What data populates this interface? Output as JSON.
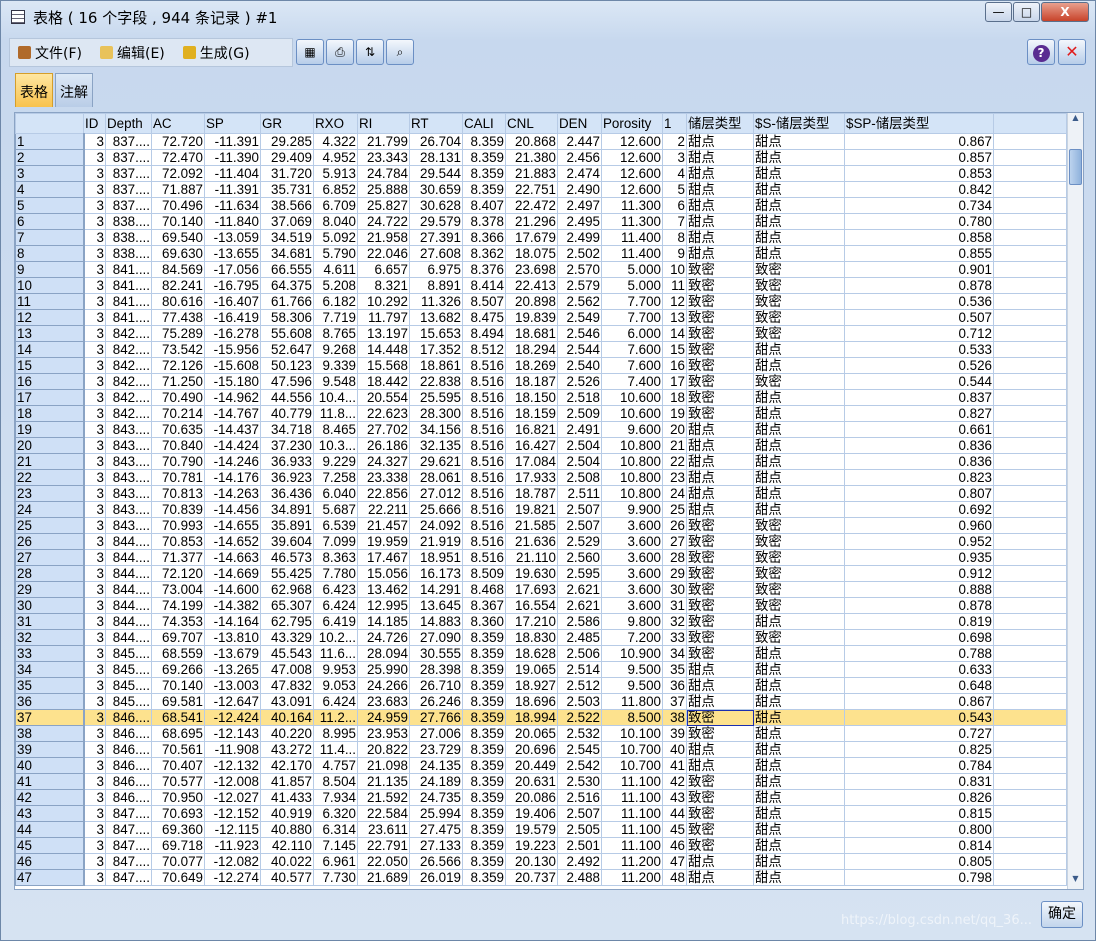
{
  "window": {
    "title": "表格 ( 16 个字段 , 944 条记录 ) #1",
    "minimize": "—",
    "maximize": "□",
    "close": "X"
  },
  "menu": [
    {
      "label": "文件(F)",
      "icon": "file-icon",
      "color": "#b06a2a"
    },
    {
      "label": "编辑(E)",
      "icon": "edit-icon",
      "color": "#e8c25a"
    },
    {
      "label": "生成(G)",
      "icon": "generate-icon",
      "color": "#e0b020"
    }
  ],
  "toolbar": [
    {
      "name": "export-icon",
      "glyph": "▦"
    },
    {
      "name": "print-icon",
      "glyph": "⎙"
    },
    {
      "name": "sort-icon",
      "glyph": "⇅"
    },
    {
      "name": "find-icon",
      "glyph": "⌕"
    }
  ],
  "help_label": "?",
  "close_label": "✕",
  "tabs": [
    {
      "label": "表格",
      "active": true
    },
    {
      "label": "注解",
      "active": false
    }
  ],
  "columns": [
    "",
    "ID",
    "Depth",
    "AC",
    "SP",
    "GR",
    "RXO",
    "RI",
    "RT",
    "CALI",
    "CNL",
    "DEN",
    "Porosity",
    "1",
    "储层类型",
    "$S-储层类型",
    "$SP-储层类型"
  ],
  "rows": [
    [
      "1",
      "3",
      "837....",
      "72.720",
      "-11.391",
      "29.285",
      "4.322",
      "21.799",
      "26.704",
      "8.359",
      "20.868",
      "2.447",
      "12.600",
      "2",
      "甜点",
      "甜点",
      "0.867"
    ],
    [
      "2",
      "3",
      "837....",
      "72.470",
      "-11.390",
      "29.409",
      "4.952",
      "23.343",
      "28.131",
      "8.359",
      "21.380",
      "2.456",
      "12.600",
      "3",
      "甜点",
      "甜点",
      "0.857"
    ],
    [
      "3",
      "3",
      "837....",
      "72.092",
      "-11.404",
      "31.720",
      "5.913",
      "24.784",
      "29.544",
      "8.359",
      "21.883",
      "2.474",
      "12.600",
      "4",
      "甜点",
      "甜点",
      "0.853"
    ],
    [
      "4",
      "3",
      "837....",
      "71.887",
      "-11.391",
      "35.731",
      "6.852",
      "25.888",
      "30.659",
      "8.359",
      "22.751",
      "2.490",
      "12.600",
      "5",
      "甜点",
      "甜点",
      "0.842"
    ],
    [
      "5",
      "3",
      "837....",
      "70.496",
      "-11.634",
      "38.566",
      "6.709",
      "25.827",
      "30.628",
      "8.407",
      "22.472",
      "2.497",
      "11.300",
      "6",
      "甜点",
      "甜点",
      "0.734"
    ],
    [
      "6",
      "3",
      "838....",
      "70.140",
      "-11.840",
      "37.069",
      "8.040",
      "24.722",
      "29.579",
      "8.378",
      "21.296",
      "2.495",
      "11.300",
      "7",
      "甜点",
      "甜点",
      "0.780"
    ],
    [
      "7",
      "3",
      "838....",
      "69.540",
      "-13.059",
      "34.519",
      "5.092",
      "21.958",
      "27.391",
      "8.366",
      "17.679",
      "2.499",
      "11.400",
      "8",
      "甜点",
      "甜点",
      "0.858"
    ],
    [
      "8",
      "3",
      "838....",
      "69.630",
      "-13.655",
      "34.681",
      "5.790",
      "22.046",
      "27.608",
      "8.362",
      "18.075",
      "2.502",
      "11.400",
      "9",
      "甜点",
      "甜点",
      "0.855"
    ],
    [
      "9",
      "3",
      "841....",
      "84.569",
      "-17.056",
      "66.555",
      "4.611",
      "6.657",
      "6.975",
      "8.376",
      "23.698",
      "2.570",
      "5.000",
      "10",
      "致密",
      "致密",
      "0.901"
    ],
    [
      "10",
      "3",
      "841....",
      "82.241",
      "-16.795",
      "64.375",
      "5.208",
      "8.321",
      "8.891",
      "8.414",
      "22.413",
      "2.579",
      "5.000",
      "11",
      "致密",
      "致密",
      "0.878"
    ],
    [
      "11",
      "3",
      "841....",
      "80.616",
      "-16.407",
      "61.766",
      "6.182",
      "10.292",
      "11.326",
      "8.507",
      "20.898",
      "2.562",
      "7.700",
      "12",
      "致密",
      "致密",
      "0.536"
    ],
    [
      "12",
      "3",
      "841....",
      "77.438",
      "-16.419",
      "58.306",
      "7.719",
      "11.797",
      "13.682",
      "8.475",
      "19.839",
      "2.549",
      "7.700",
      "13",
      "致密",
      "致密",
      "0.507"
    ],
    [
      "13",
      "3",
      "842....",
      "75.289",
      "-16.278",
      "55.608",
      "8.765",
      "13.197",
      "15.653",
      "8.494",
      "18.681",
      "2.546",
      "6.000",
      "14",
      "致密",
      "致密",
      "0.712"
    ],
    [
      "14",
      "3",
      "842....",
      "73.542",
      "-15.956",
      "52.647",
      "9.268",
      "14.448",
      "17.352",
      "8.512",
      "18.294",
      "2.544",
      "7.600",
      "15",
      "致密",
      "甜点",
      "0.533"
    ],
    [
      "15",
      "3",
      "842....",
      "72.126",
      "-15.608",
      "50.123",
      "9.339",
      "15.568",
      "18.861",
      "8.516",
      "18.269",
      "2.540",
      "7.600",
      "16",
      "致密",
      "甜点",
      "0.526"
    ],
    [
      "16",
      "3",
      "842....",
      "71.250",
      "-15.180",
      "47.596",
      "9.548",
      "18.442",
      "22.838",
      "8.516",
      "18.187",
      "2.526",
      "7.400",
      "17",
      "致密",
      "致密",
      "0.544"
    ],
    [
      "17",
      "3",
      "842....",
      "70.490",
      "-14.962",
      "44.556",
      "10.4...",
      "20.554",
      "25.595",
      "8.516",
      "18.150",
      "2.518",
      "10.600",
      "18",
      "致密",
      "甜点",
      "0.837"
    ],
    [
      "18",
      "3",
      "842....",
      "70.214",
      "-14.767",
      "40.779",
      "11.8...",
      "22.623",
      "28.300",
      "8.516",
      "18.159",
      "2.509",
      "10.600",
      "19",
      "致密",
      "甜点",
      "0.827"
    ],
    [
      "19",
      "3",
      "843....",
      "70.635",
      "-14.437",
      "34.718",
      "8.465",
      "27.702",
      "34.156",
      "8.516",
      "16.821",
      "2.491",
      "9.600",
      "20",
      "甜点",
      "甜点",
      "0.661"
    ],
    [
      "20",
      "3",
      "843....",
      "70.840",
      "-14.424",
      "37.230",
      "10.3...",
      "26.186",
      "32.135",
      "8.516",
      "16.427",
      "2.504",
      "10.800",
      "21",
      "甜点",
      "甜点",
      "0.836"
    ],
    [
      "21",
      "3",
      "843....",
      "70.790",
      "-14.246",
      "36.933",
      "9.229",
      "24.327",
      "29.621",
      "8.516",
      "17.084",
      "2.504",
      "10.800",
      "22",
      "甜点",
      "甜点",
      "0.836"
    ],
    [
      "22",
      "3",
      "843....",
      "70.781",
      "-14.176",
      "36.923",
      "7.258",
      "23.338",
      "28.061",
      "8.516",
      "17.933",
      "2.508",
      "10.800",
      "23",
      "甜点",
      "甜点",
      "0.823"
    ],
    [
      "23",
      "3",
      "843....",
      "70.813",
      "-14.263",
      "36.436",
      "6.040",
      "22.856",
      "27.012",
      "8.516",
      "18.787",
      "2.511",
      "10.800",
      "24",
      "甜点",
      "甜点",
      "0.807"
    ],
    [
      "24",
      "3",
      "843....",
      "70.839",
      "-14.456",
      "34.891",
      "5.687",
      "22.211",
      "25.666",
      "8.516",
      "19.821",
      "2.507",
      "9.900",
      "25",
      "甜点",
      "甜点",
      "0.692"
    ],
    [
      "25",
      "3",
      "843....",
      "70.993",
      "-14.655",
      "35.891",
      "6.539",
      "21.457",
      "24.092",
      "8.516",
      "21.585",
      "2.507",
      "3.600",
      "26",
      "致密",
      "致密",
      "0.960"
    ],
    [
      "26",
      "3",
      "844....",
      "70.853",
      "-14.652",
      "39.604",
      "7.099",
      "19.959",
      "21.919",
      "8.516",
      "21.636",
      "2.529",
      "3.600",
      "27",
      "致密",
      "致密",
      "0.952"
    ],
    [
      "27",
      "3",
      "844....",
      "71.377",
      "-14.663",
      "46.573",
      "8.363",
      "17.467",
      "18.951",
      "8.516",
      "21.110",
      "2.560",
      "3.600",
      "28",
      "致密",
      "致密",
      "0.935"
    ],
    [
      "28",
      "3",
      "844....",
      "72.120",
      "-14.669",
      "55.425",
      "7.780",
      "15.056",
      "16.173",
      "8.509",
      "19.630",
      "2.595",
      "3.600",
      "29",
      "致密",
      "致密",
      "0.912"
    ],
    [
      "29",
      "3",
      "844....",
      "73.004",
      "-14.600",
      "62.968",
      "6.423",
      "13.462",
      "14.291",
      "8.468",
      "17.693",
      "2.621",
      "3.600",
      "30",
      "致密",
      "致密",
      "0.888"
    ],
    [
      "30",
      "3",
      "844....",
      "74.199",
      "-14.382",
      "65.307",
      "6.424",
      "12.995",
      "13.645",
      "8.367",
      "16.554",
      "2.621",
      "3.600",
      "31",
      "致密",
      "致密",
      "0.878"
    ],
    [
      "31",
      "3",
      "844....",
      "74.353",
      "-14.164",
      "62.795",
      "6.419",
      "14.185",
      "14.883",
      "8.360",
      "17.210",
      "2.586",
      "9.800",
      "32",
      "致密",
      "甜点",
      "0.819"
    ],
    [
      "32",
      "3",
      "844....",
      "69.707",
      "-13.810",
      "43.329",
      "10.2...",
      "24.726",
      "27.090",
      "8.359",
      "18.830",
      "2.485",
      "7.200",
      "33",
      "致密",
      "致密",
      "0.698"
    ],
    [
      "33",
      "3",
      "845....",
      "68.559",
      "-13.679",
      "45.543",
      "11.6...",
      "28.094",
      "30.555",
      "8.359",
      "18.628",
      "2.506",
      "10.900",
      "34",
      "致密",
      "甜点",
      "0.788"
    ],
    [
      "34",
      "3",
      "845....",
      "69.266",
      "-13.265",
      "47.008",
      "9.953",
      "25.990",
      "28.398",
      "8.359",
      "19.065",
      "2.514",
      "9.500",
      "35",
      "甜点",
      "甜点",
      "0.633"
    ],
    [
      "35",
      "3",
      "845....",
      "70.140",
      "-13.003",
      "47.832",
      "9.053",
      "24.266",
      "26.710",
      "8.359",
      "18.927",
      "2.512",
      "9.500",
      "36",
      "甜点",
      "甜点",
      "0.648"
    ],
    [
      "36",
      "3",
      "845....",
      "69.581",
      "-12.647",
      "43.091",
      "6.424",
      "23.683",
      "26.246",
      "8.359",
      "18.696",
      "2.503",
      "11.800",
      "37",
      "甜点",
      "甜点",
      "0.867"
    ],
    [
      "37",
      "3",
      "846....",
      "68.541",
      "-12.424",
      "40.164",
      "11.2...",
      "24.959",
      "27.766",
      "8.359",
      "18.994",
      "2.522",
      "8.500",
      "38",
      "致密",
      "甜点",
      "0.543"
    ],
    [
      "38",
      "3",
      "846....",
      "68.695",
      "-12.143",
      "40.220",
      "8.995",
      "23.953",
      "27.006",
      "8.359",
      "20.065",
      "2.532",
      "10.100",
      "39",
      "致密",
      "甜点",
      "0.727"
    ],
    [
      "39",
      "3",
      "846....",
      "70.561",
      "-11.908",
      "43.272",
      "11.4...",
      "20.822",
      "23.729",
      "8.359",
      "20.696",
      "2.545",
      "10.700",
      "40",
      "甜点",
      "甜点",
      "0.825"
    ],
    [
      "40",
      "3",
      "846....",
      "70.407",
      "-12.132",
      "42.170",
      "4.757",
      "21.098",
      "24.135",
      "8.359",
      "20.449",
      "2.542",
      "10.700",
      "41",
      "甜点",
      "甜点",
      "0.784"
    ],
    [
      "41",
      "3",
      "846....",
      "70.577",
      "-12.008",
      "41.857",
      "8.504",
      "21.135",
      "24.189",
      "8.359",
      "20.631",
      "2.530",
      "11.100",
      "42",
      "致密",
      "甜点",
      "0.831"
    ],
    [
      "42",
      "3",
      "846....",
      "70.950",
      "-12.027",
      "41.433",
      "7.934",
      "21.592",
      "24.735",
      "8.359",
      "20.086",
      "2.516",
      "11.100",
      "43",
      "致密",
      "甜点",
      "0.826"
    ],
    [
      "43",
      "3",
      "847....",
      "70.693",
      "-12.152",
      "40.919",
      "6.320",
      "22.584",
      "25.994",
      "8.359",
      "19.406",
      "2.507",
      "11.100",
      "44",
      "致密",
      "甜点",
      "0.815"
    ],
    [
      "44",
      "3",
      "847....",
      "69.360",
      "-12.115",
      "40.880",
      "6.314",
      "23.611",
      "27.475",
      "8.359",
      "19.579",
      "2.505",
      "11.100",
      "45",
      "致密",
      "甜点",
      "0.800"
    ],
    [
      "45",
      "3",
      "847....",
      "69.718",
      "-11.923",
      "42.110",
      "7.145",
      "22.791",
      "27.133",
      "8.359",
      "19.223",
      "2.501",
      "11.100",
      "46",
      "致密",
      "甜点",
      "0.814"
    ],
    [
      "46",
      "3",
      "847....",
      "70.077",
      "-12.082",
      "40.022",
      "6.961",
      "22.050",
      "26.566",
      "8.359",
      "20.130",
      "2.492",
      "11.200",
      "47",
      "甜点",
      "甜点",
      "0.805"
    ],
    [
      "47",
      "3",
      "847....",
      "70.649",
      "-12.274",
      "40.577",
      "7.730",
      "21.689",
      "26.019",
      "8.359",
      "20.737",
      "2.488",
      "11.200",
      "48",
      "甜点",
      "甜点",
      "0.798"
    ]
  ],
  "selected_row": "37",
  "ok_label": "确定",
  "watermark": "https://blog.csdn.net/qq_36..."
}
